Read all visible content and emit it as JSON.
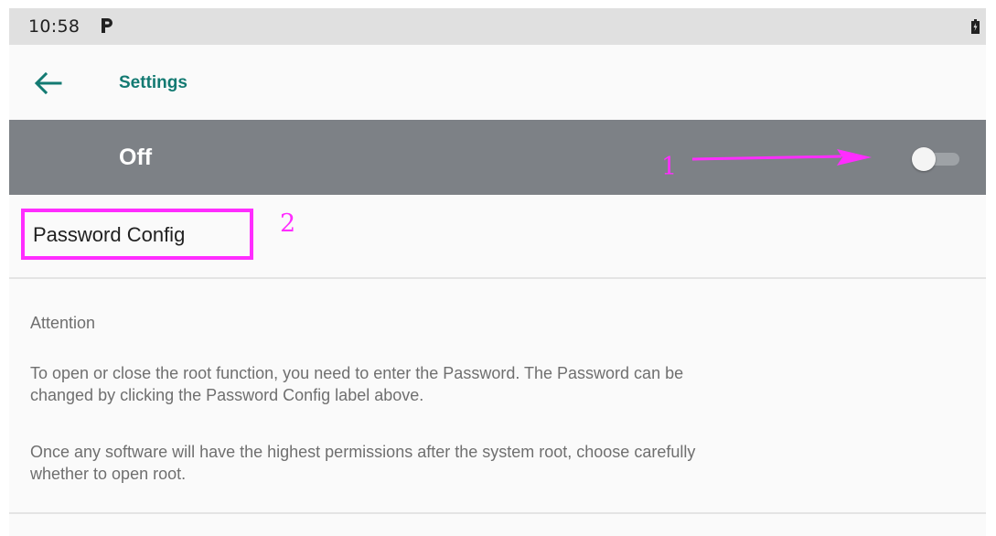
{
  "status_bar": {
    "time": "10:58",
    "notification_icon": "parking-p-icon",
    "battery_icon": "battery-icon"
  },
  "app_bar": {
    "back_icon": "arrow-left-icon",
    "title": "Settings",
    "accent_color": "#137a72"
  },
  "master_switch": {
    "label": "Off",
    "state": "off",
    "background_color": "#7d8186"
  },
  "password_config": {
    "label": "Password Config"
  },
  "attention": {
    "title": "Attention",
    "paragraph_1_line_1": "To open or close the root function, you need to enter the Password. The Password can be",
    "paragraph_1_line_2": "changed by clicking the Password Config label above.",
    "paragraph_2_line_1": "Once any software will have the highest permissions after the system root, choose carefully",
    "paragraph_2_line_2": "whether to open root."
  },
  "annotations": {
    "marker_1": "1",
    "marker_2": "2",
    "color": "#ff2dff"
  }
}
